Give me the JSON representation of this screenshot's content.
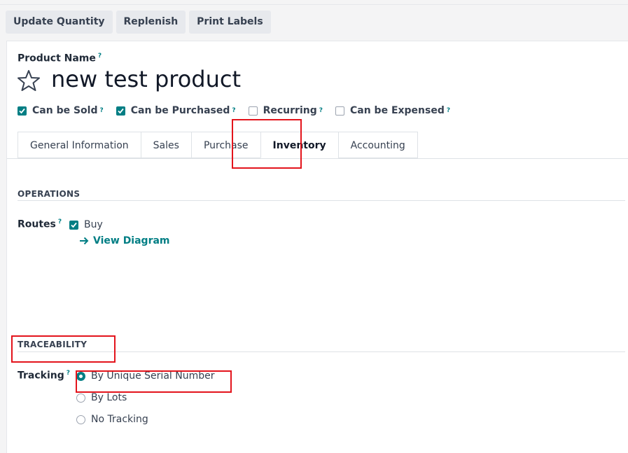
{
  "toolbar": {
    "update_quantity": "Update Quantity",
    "replenish": "Replenish",
    "print_labels": "Print Labels"
  },
  "product": {
    "name_label": "Product Name",
    "help": "?",
    "title": "new test product"
  },
  "options": [
    {
      "label": "Can be Sold",
      "checked": true
    },
    {
      "label": "Can be Purchased",
      "checked": true
    },
    {
      "label": "Recurring",
      "checked": false
    },
    {
      "label": "Can be Expensed",
      "checked": false
    }
  ],
  "tabs": [
    "General Information",
    "Sales",
    "Purchase",
    "Inventory",
    "Accounting"
  ],
  "active_tab": "Inventory",
  "operations": {
    "title": "OPERATIONS",
    "routes_label": "Routes",
    "route_buy": "Buy",
    "view_diagram": "View Diagram"
  },
  "traceability": {
    "title": "TRACEABILITY",
    "tracking_label": "Tracking",
    "options": [
      "By Unique Serial Number",
      "By Lots",
      "No Tracking"
    ],
    "selected": "By Unique Serial Number"
  },
  "colors": {
    "accent": "#017e84",
    "annotation": "#e3141c"
  }
}
